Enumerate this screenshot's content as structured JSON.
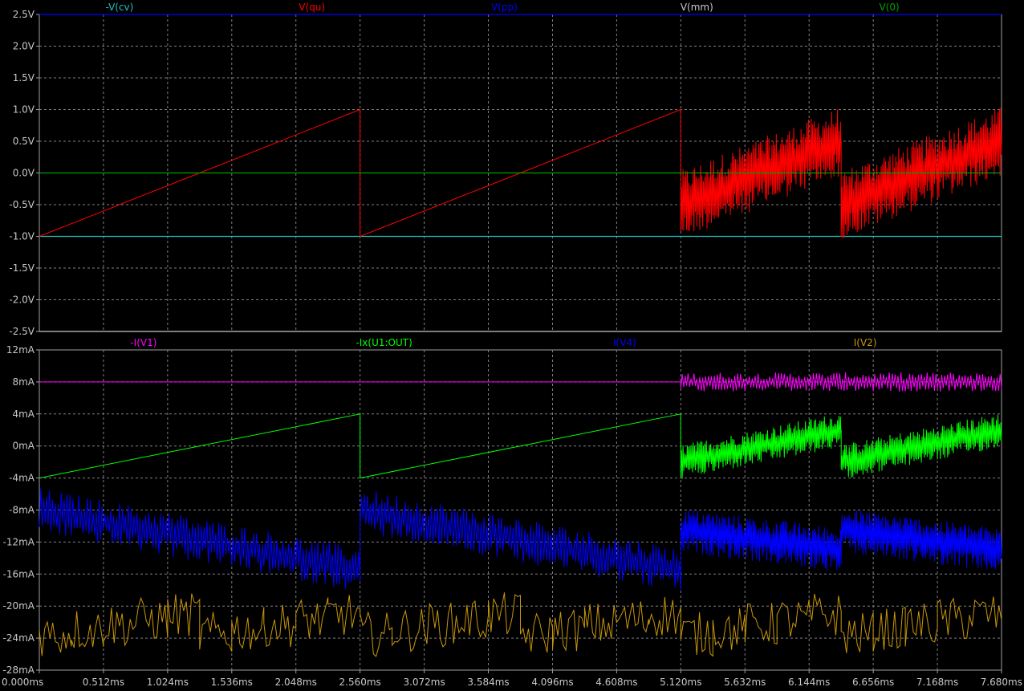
{
  "chart_data": [
    {
      "type": "line",
      "title": "",
      "xlabel": "",
      "ylabel": "",
      "xlim": [
        0,
        7.68
      ],
      "ylim": [
        -2.5,
        2.5
      ],
      "x_unit": "ms",
      "y_unit": "V",
      "grid": true,
      "x_ticks": [
        "0.000ms",
        "0.512ms",
        "1.024ms",
        "1.536ms",
        "2.048ms",
        "2.560ms",
        "3.072ms",
        "3.584ms",
        "4.096ms",
        "4.608ms",
        "5.120ms",
        "5.632ms",
        "6.144ms",
        "6.656ms",
        "7.168ms",
        "7.680ms"
      ],
      "y_ticks": [
        "2.5V",
        "2.0V",
        "1.5V",
        "1.0V",
        "0.5V",
        "0.0V",
        "-0.5V",
        "-1.0V",
        "-1.5V",
        "-2.0V",
        "-2.5V"
      ],
      "series": [
        {
          "name": "-V(cv)",
          "color": "#20c0c0",
          "shape": "constant",
          "x": [
            0,
            7.68
          ],
          "y": [
            -1.0,
            -1.0
          ]
        },
        {
          "name": "V(qu)",
          "color": "#ff0000",
          "shape": "sawtooth",
          "x": [
            0,
            2.56,
            2.56,
            5.12,
            5.12,
            6.4,
            6.4,
            7.68
          ],
          "y": [
            -1.0,
            1.0,
            -1.0,
            1.0,
            -0.5,
            0.5,
            -0.5,
            0.5
          ],
          "noise_band": 0.55
        },
        {
          "name": "V(pp)",
          "color": "#0000ff",
          "shape": "constant",
          "x": [
            0,
            7.68
          ],
          "y": [
            2.5,
            2.5
          ]
        },
        {
          "name": "V(mm)",
          "color": "#c8c8c8",
          "shape": "constant",
          "x": [
            0,
            7.68
          ],
          "y": [
            -2.5,
            -2.5
          ]
        },
        {
          "name": "V(0)",
          "color": "#00a000",
          "shape": "constant",
          "x": [
            0,
            7.68
          ],
          "y": [
            0.0,
            0.0
          ]
        }
      ]
    },
    {
      "type": "line",
      "title": "",
      "xlabel": "",
      "ylabel": "",
      "xlim": [
        0,
        7.68
      ],
      "ylim": [
        -28,
        12
      ],
      "x_unit": "ms",
      "y_unit": "mA",
      "grid": true,
      "x_ticks": [
        "0.000ms",
        "0.512ms",
        "1.024ms",
        "1.536ms",
        "2.048ms",
        "2.560ms",
        "3.072ms",
        "3.584ms",
        "4.096ms",
        "4.608ms",
        "5.120ms",
        "5.632ms",
        "6.144ms",
        "6.656ms",
        "7.168ms",
        "7.680ms"
      ],
      "y_ticks": [
        "12mA",
        "8mA",
        "4mA",
        "0mA",
        "-4mA",
        "-8mA",
        "-12mA",
        "-16mA",
        "-20mA",
        "-24mA",
        "-28mA"
      ],
      "series": [
        {
          "name": "-I(V1)",
          "color": "#ff00ff",
          "shape": "constant",
          "x": [
            0,
            5.12,
            5.12,
            7.68
          ],
          "y": [
            8.0,
            8.0,
            8.0,
            8.0
          ],
          "noise_band": 1.2
        },
        {
          "name": "-Ix(U1:OUT)",
          "color": "#00ff00",
          "shape": "sawtooth",
          "x": [
            0,
            2.56,
            2.56,
            5.12,
            5.12,
            6.4,
            6.4,
            7.68
          ],
          "y": [
            -4.0,
            4.0,
            -4.0,
            4.0,
            -2.0,
            2.0,
            -2.0,
            2.0
          ],
          "noise_band": 2.2
        },
        {
          "name": "I(V4)",
          "color": "#0000ff",
          "shape": "sawtooth",
          "x": [
            0,
            2.56,
            2.56,
            5.12,
            5.12,
            6.4,
            6.4,
            7.68
          ],
          "y": [
            -8.0,
            -15.5,
            -8.0,
            -15.5,
            -10.5,
            -13.0,
            -10.5,
            -13.0
          ],
          "noise_band": 2.8
        },
        {
          "name": "I(V2)",
          "color": "#c8960a",
          "shape": "staircase",
          "x": [
            0,
            7.68
          ],
          "y": [
            -23.5,
            -22.0
          ],
          "noise_band": 2.8
        }
      ]
    }
  ]
}
